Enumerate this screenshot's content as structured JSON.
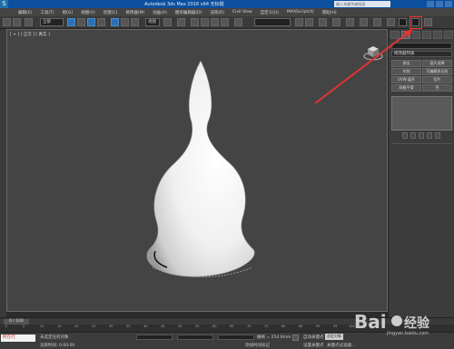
{
  "title_bar": {
    "title": "Autodesk 3ds Max 2016 x64 无标题",
    "search_placeholder": "键入关键字或短语"
  },
  "menu": [
    "编辑(E)",
    "工具(T)",
    "组(G)",
    "视图(V)",
    "创建(C)",
    "修改器(M)",
    "动画(A)",
    "图形编辑器(D)",
    "渲染(R)",
    "Civil View",
    "自定义(U)",
    "MAXScript(X)",
    "帮助(H)"
  ],
  "toolbar": {
    "selection_set": "全部",
    "view_dropdown": "视图"
  },
  "viewport": {
    "label": "[ + ] [ 正交 ] [ 真实 ]"
  },
  "command_panel": {
    "modifier_list": "修改器列表",
    "buttons": [
      "挤出",
      "面片选择",
      "车削",
      "可编辑多边形",
      "UVW 展开",
      "切片",
      "网格平滑",
      "壳"
    ]
  },
  "timeline": {
    "frame_counter": "0 / 100",
    "ruler_ticks": [
      "0",
      "5",
      "10",
      "15",
      "20",
      "25",
      "30",
      "35",
      "40",
      "45",
      "50",
      "55",
      "60",
      "65",
      "70",
      "75",
      "80",
      "85",
      "90",
      "95",
      "100"
    ]
  },
  "status": {
    "running_label": "所在行:",
    "selection_text": "未选定任何对象",
    "hint_text": "渲染时间: 0:00:00",
    "grid_text": "栅格 = 254.0mm",
    "autokey_label": "自动关键点",
    "setkey_label": "设置关键点",
    "selected_button": "选定对象",
    "keyfilter_label": "关键点过滤器...",
    "add_time_tag": "添加时间标记"
  },
  "colors": {
    "accent": "#e33333",
    "viewport_bg": "#444444",
    "titlebar": "#0b4f9e"
  }
}
